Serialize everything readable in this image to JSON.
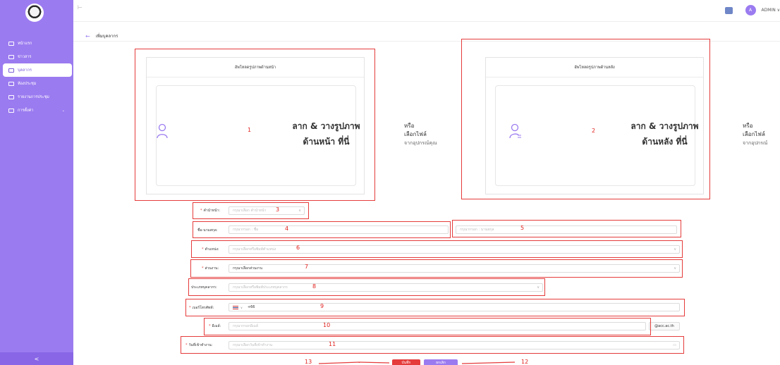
{
  "sidebar": {
    "items": [
      {
        "label": "หน้าแรก",
        "icon": "dashboard-icon",
        "active": false
      },
      {
        "label": "ข่าวสาร",
        "icon": "megaphone-icon",
        "active": false
      },
      {
        "label": "บุคลากร",
        "icon": "people-icon",
        "active": true
      },
      {
        "label": "ห้องประชุม",
        "icon": "room-icon",
        "active": false
      },
      {
        "label": "รายงานการประชุม",
        "icon": "report-icon",
        "active": false
      },
      {
        "label": "การตั้งค่า",
        "icon": "gear-icon",
        "active": false
      }
    ],
    "collapse_symbol": "<"
  },
  "header": {
    "user_initial": "A",
    "user_label": "ADMIN ∨"
  },
  "page": {
    "title": "เพิ่มบุคลากร",
    "back_symbol": "←"
  },
  "upload_front": {
    "title": "อัพโหลดรูปภาพด้านหน้า",
    "drop_line1": "ลาก & วางรูปภาพ",
    "drop_line2": "ด้านหน้า ที่นี่",
    "or": "หรือ",
    "choose": "เลือกไฟล์",
    "from_device": "จากอุปกรณ์คุณ"
  },
  "upload_back": {
    "title": "อัพโหลดรูปภาพด้านหลัง",
    "drop_line1": "ลาก & วางรูปภาพ",
    "drop_line2": "ด้านหลัง ที่นี่",
    "or": "หรือ",
    "choose": "เลือกไฟล์",
    "from_device": "จากอุปกรณ์"
  },
  "form": {
    "prefix_label": "คำนำหน้า:",
    "prefix_placeholder": "กรุณาเลือก คำนำหน้า",
    "name_label": "ชื่อ-นามสกุล:",
    "firstname_placeholder": "กรุณากรอก : ชื่อ",
    "lastname_placeholder": "กรุณากรอก : นามสกุล",
    "position_label": "ตำแหน่ง:",
    "position_placeholder": "กรุณาเลือกหรือพิมพ์ตำแหน่ง",
    "department_label": "ส่วนงาน:",
    "department_value": "กรุณาเลือกส่วนงาน",
    "type_label": "ประเภทบุคลากร:",
    "type_placeholder": "กรุณาเลือกหรือพิมพ์ประเภทบุคลากร",
    "phone_label": "เบอร์โทรศัพท์:",
    "phone_code": "+66",
    "email_label": "อีเมล์:",
    "email_placeholder": "กรุณากรอกอีเมล์",
    "email_suffix": "@acc.ac.th",
    "startdate_label": "วันที่เข้าทำงาน:",
    "startdate_placeholder": "กรุณาเลือกวันที่เข้าทำงาน"
  },
  "buttons": {
    "save": "บันทึก",
    "cancel": "ยกเลิก"
  },
  "annotations": [
    "1",
    "2",
    "3",
    "4",
    "5",
    "6",
    "7",
    "8",
    "9",
    "10",
    "11",
    "12",
    "13"
  ],
  "colors": {
    "primary": "#9b7bf0",
    "annotation_red": "#e53b3b"
  }
}
